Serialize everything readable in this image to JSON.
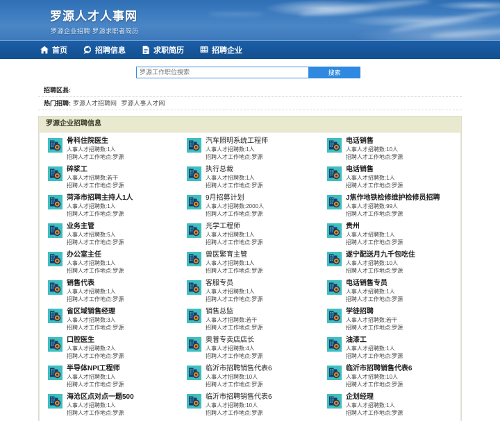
{
  "site": {
    "brand": "罗源人才人事网",
    "slogan": "罗源企业招聘 罗源求职者简历"
  },
  "nav": {
    "items": [
      {
        "label": "首页",
        "icon": "home-icon"
      },
      {
        "label": "招聘信息",
        "icon": "megaphone-icon"
      },
      {
        "label": "求职简历",
        "icon": "document-icon"
      },
      {
        "label": "招聘企业",
        "icon": "building-icon"
      }
    ]
  },
  "search": {
    "placeholder": "罗源工作职位搜索",
    "value": "",
    "button_label": "搜索"
  },
  "filters": [
    {
      "label": "招聘区县:",
      "links": []
    },
    {
      "label": "热门招聘:",
      "links": [
        "罗源人才招聘网",
        "罗源人事人才网"
      ]
    }
  ],
  "section": {
    "title": "罗源企业招聘信息",
    "meta_count_prefix": "人事人才招聘数:",
    "meta_place_prefix": "招聘人才工作地点:",
    "columns": [
      {
        "jobs": [
          {
            "title": "骨科住院医生",
            "count": "1人",
            "place": "罗源"
          },
          {
            "title": "碎浆工",
            "count": "若干",
            "place": "罗源"
          },
          {
            "title": "菏泽市招聘主持人1人",
            "count": "1人",
            "place": "罗源"
          },
          {
            "title": "业务主管",
            "count": "5人",
            "place": "罗源"
          },
          {
            "title": "办公室主任",
            "count": "1人",
            "place": "罗源"
          },
          {
            "title": "销售代表",
            "count": "1人",
            "place": "罗源"
          },
          {
            "title": "省区域销售经理",
            "count": "3人",
            "place": "罗源"
          },
          {
            "title": "口腔医生",
            "count": "2人",
            "place": "罗源"
          },
          {
            "title": "半导体NPI工程师",
            "count": "1人",
            "place": "罗源"
          },
          {
            "title": "海沧区点对点一题500",
            "count": "1人",
            "place": "罗源"
          }
        ]
      },
      {
        "jobs": [
          {
            "title": "汽车照明系统工程师",
            "count": "1人",
            "place": "罗源"
          },
          {
            "title": "执行总裁",
            "count": "1人",
            "place": "罗源"
          },
          {
            "title": "9月招募计划",
            "count": "2000人",
            "place": "罗源"
          },
          {
            "title": "光学工程师",
            "count": "1人",
            "place": "罗源"
          },
          {
            "title": "兽医繁育主管",
            "count": "1人",
            "place": "罗源"
          },
          {
            "title": "客服专员",
            "count": "1人",
            "place": "罗源"
          },
          {
            "title": "销售总监",
            "count": "若干",
            "place": "罗源"
          },
          {
            "title": "奥普专卖店店长",
            "count": "4人",
            "place": "罗源"
          },
          {
            "title": "临沂市招聘销售代表6",
            "count": "10人",
            "place": "罗源"
          },
          {
            "title": "临沂市招聘销售代表6",
            "count": "10人",
            "place": "罗源"
          }
        ]
      },
      {
        "jobs": [
          {
            "title": "电话销售",
            "count": "10人",
            "place": "罗源"
          },
          {
            "title": "电话销售",
            "count": "1人",
            "place": "罗源"
          },
          {
            "title": "J焦作地铁检修维护检修员招聘",
            "count": "99人",
            "place": "罗源"
          },
          {
            "title": "贵州",
            "count": "1人",
            "place": "罗源"
          },
          {
            "title": "遂宁配送月九千包吃住",
            "count": "10人",
            "place": "罗源"
          },
          {
            "title": "电话销售专员",
            "count": "1人",
            "place": "罗源"
          },
          {
            "title": "学徒招聘",
            "count": "若干",
            "place": "罗源"
          },
          {
            "title": "油漆工",
            "count": "1人",
            "place": "罗源"
          },
          {
            "title": "临沂市招聘销售代表6",
            "count": "10人",
            "place": "罗源"
          },
          {
            "title": "企划经理",
            "count": "1人",
            "place": "罗源"
          }
        ]
      }
    ]
  },
  "colors": {
    "banner_blue": "#3d7cc0",
    "nav_blue": "#17569c",
    "accent_blue": "#2f89e0",
    "panel_head": "#e9e9cf",
    "icon_teal": "#3fbfbf",
    "icon_navy": "#1b3a6b",
    "icon_orange": "#e08a1e"
  }
}
